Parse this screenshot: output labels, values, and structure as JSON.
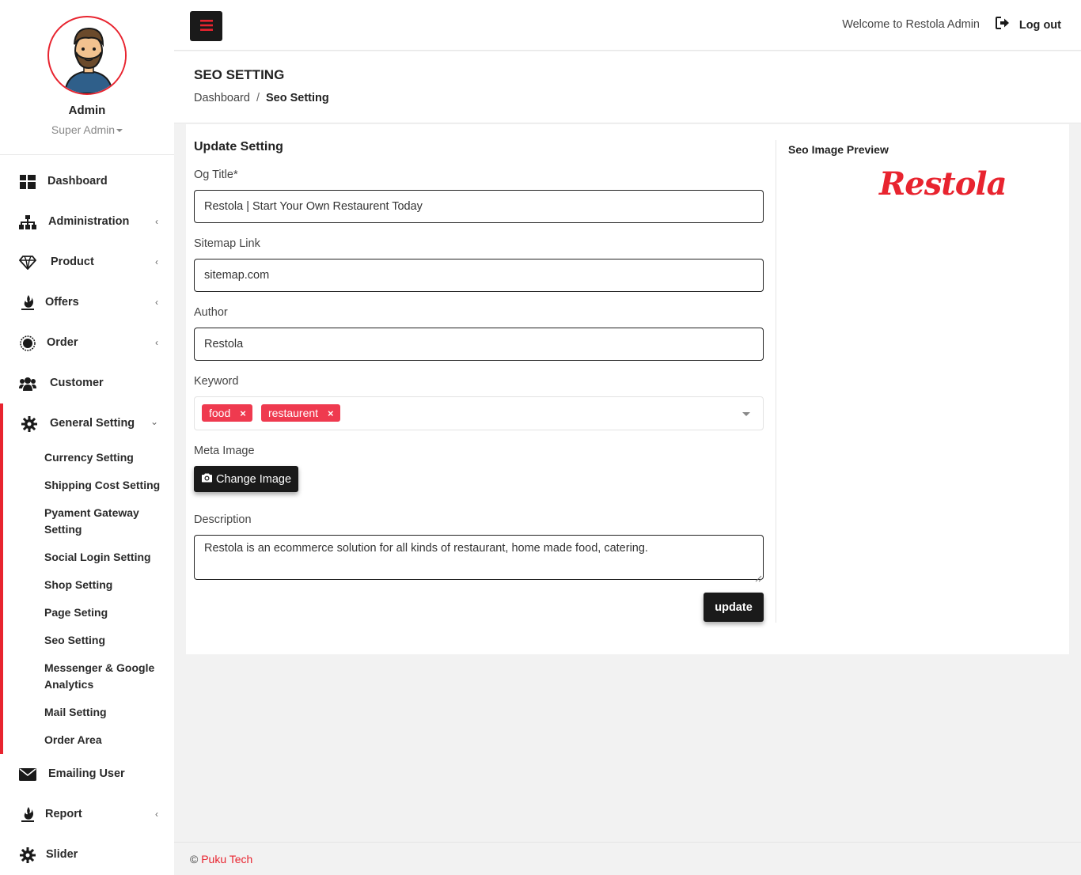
{
  "profile": {
    "name": "Admin",
    "role": "Super Admin"
  },
  "sidebar": {
    "items": [
      {
        "label": "Dashboard",
        "icon": "dashboard-icon"
      },
      {
        "label": "Administration",
        "icon": "sitemap-icon"
      },
      {
        "label": "Product",
        "icon": "diamond-icon"
      },
      {
        "label": "Offers",
        "icon": "fire-icon"
      },
      {
        "label": "Order",
        "icon": "order-icon"
      },
      {
        "label": "Customer",
        "icon": "users-icon"
      },
      {
        "label": "General Setting",
        "icon": "gear-icon"
      },
      {
        "label": "Emailing User",
        "icon": "envelope-icon"
      },
      {
        "label": "Report",
        "icon": "fire-icon"
      },
      {
        "label": "Slider",
        "icon": "gear-icon"
      }
    ],
    "sub_items": [
      "Currency Setting",
      "Shipping Cost Setting",
      "Pyament Gateway Setting",
      "Social Login Setting",
      "Shop Setting",
      "Page Seting",
      "Seo Setting",
      "Messenger & Google Analytics",
      "Mail Setting",
      "Order Area"
    ]
  },
  "topbar": {
    "welcome": "Welcome to Restola Admin",
    "logout": "Log out"
  },
  "page": {
    "title": "SEO SETTING",
    "breadcrumb": [
      "Dashboard",
      "Seo Setting"
    ]
  },
  "form": {
    "heading": "Update Setting",
    "og_title_label": "Og Title*",
    "og_title_value": "Restola | Start Your Own Restaurent Today",
    "sitemap_label": "Sitemap Link",
    "sitemap_value": "sitemap.com",
    "author_label": "Author",
    "author_value": "Restola",
    "keyword_label": "Keyword",
    "keywords": [
      "food",
      "restaurent"
    ],
    "tag_remove": "×",
    "meta_image_label": "Meta Image",
    "change_image": "Change Image",
    "description_label": "Description",
    "description_value": "Restola is an ecommerce solution for all kinds of restaurant, home made food, catering.",
    "update": "update"
  },
  "preview": {
    "title": "Seo Image Preview",
    "logo_text": "Restola"
  },
  "footer": {
    "copyright": "©",
    "company": "Puku Tech"
  },
  "colors": {
    "accent": "#e8242f",
    "tag": "#ef3a4f",
    "dark_button": "#1a1a1a"
  }
}
